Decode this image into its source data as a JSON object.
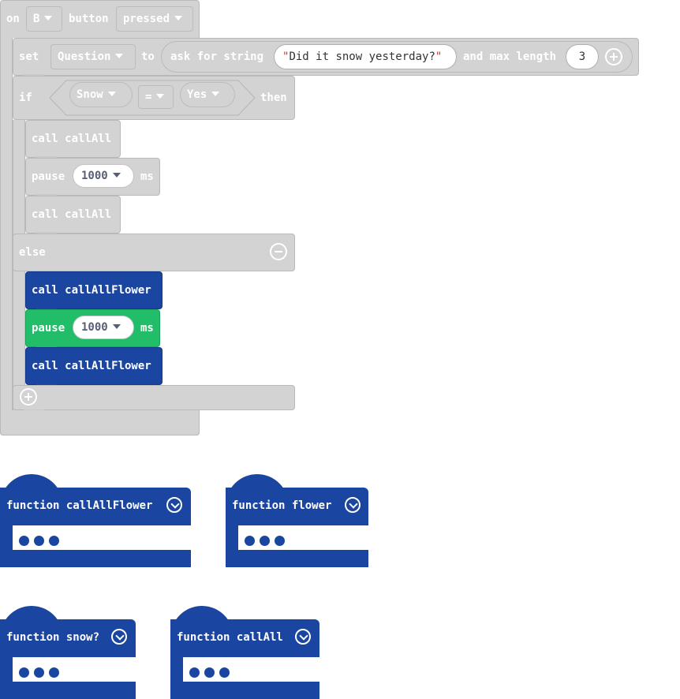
{
  "event": {
    "on": "on",
    "button_value": "B",
    "button_text": "button",
    "action_value": "pressed"
  },
  "set_block": {
    "set": "set",
    "variable": "Question",
    "to": "to",
    "ask": "ask for string",
    "prompt": "Did it snow yesterday?",
    "and_max": "and max length",
    "max_length": "3"
  },
  "if_block": {
    "if": "if",
    "left": "Snow",
    "op": "=",
    "right": "Yes",
    "then": "then",
    "else": "else"
  },
  "then_branch": [
    {
      "kind": "call",
      "label": "call callAll"
    },
    {
      "kind": "pause",
      "label": "pause",
      "value": "1000",
      "unit": "ms"
    },
    {
      "kind": "call",
      "label": "call callAll"
    }
  ],
  "else_branch": [
    {
      "kind": "call",
      "label": "call callAllFlower"
    },
    {
      "kind": "pause",
      "label": "pause",
      "value": "1000",
      "unit": "ms"
    },
    {
      "kind": "call",
      "label": "call callAllFlower"
    }
  ],
  "functions": [
    {
      "title": "function callAllFlower"
    },
    {
      "title": "function flower"
    },
    {
      "title": "function snow?"
    },
    {
      "title": "function callAll"
    }
  ],
  "colors": {
    "disabled": "#d3d3d3",
    "function_blue": "#1a45a0",
    "pause_green": "#21bd68"
  },
  "icons": {
    "dropdown": "caret-down-icon",
    "collapse": "chevron-down-icon",
    "remove": "minus-circle-icon",
    "add": "plus-circle-icon"
  }
}
